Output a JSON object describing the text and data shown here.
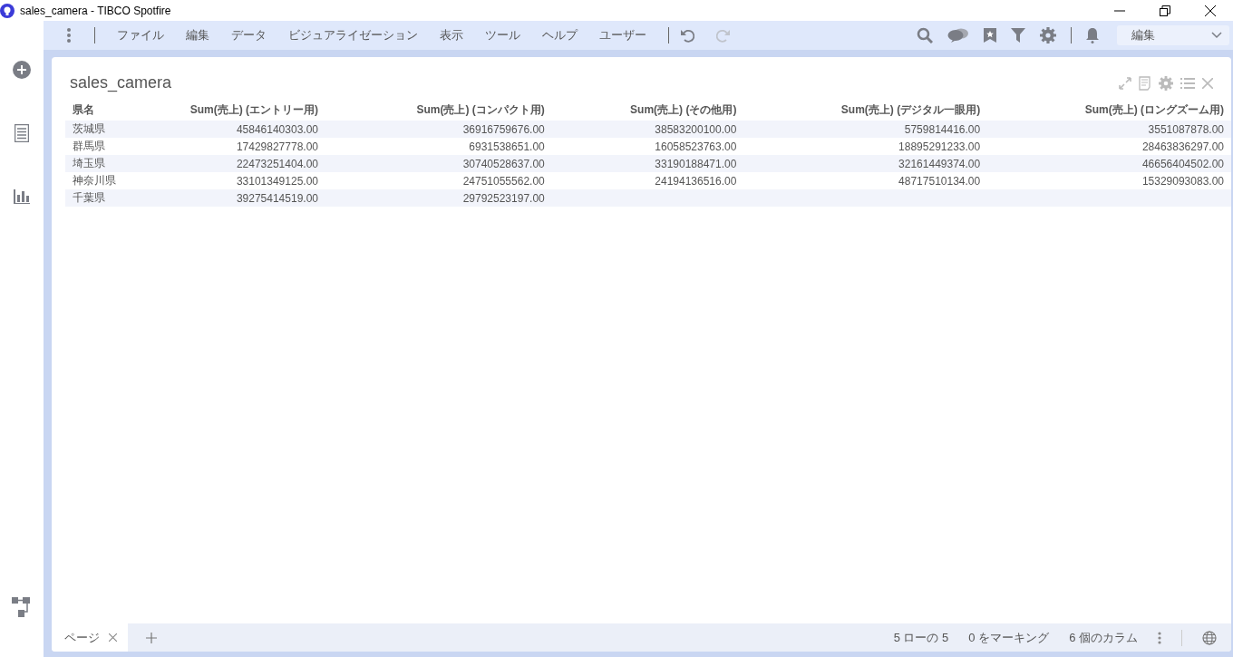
{
  "window": {
    "title": "sales_camera - TIBCO Spotfire"
  },
  "menu": [
    "ファイル",
    "編集",
    "データ",
    "ビジュアライゼーション",
    "表示",
    "ツール",
    "ヘルプ",
    "ユーザー"
  ],
  "mode_dropdown": {
    "value": "編集"
  },
  "visualization": {
    "title": "sales_camera",
    "table": {
      "columns": [
        "県名",
        "Sum(売上) (エントリー用)",
        "Sum(売上) (コンパクト用)",
        "Sum(売上) (その他用)",
        "Sum(売上) (デジタル一眼用)",
        "Sum(売上) (ロングズーム用)"
      ],
      "rows": [
        [
          "茨城県",
          "45846140303.00",
          "36916759676.00",
          "38583200100.00",
          "5759814416.00",
          "3551087878.00"
        ],
        [
          "群馬県",
          "17429827778.00",
          "6931538651.00",
          "16058523763.00",
          "18895291233.00",
          "28463836297.00"
        ],
        [
          "埼玉県",
          "22473251404.00",
          "30740528637.00",
          "33190188471.00",
          "32161449374.00",
          "46656404502.00"
        ],
        [
          "神奈川県",
          "33101349125.00",
          "24751055562.00",
          "24194136516.00",
          "48717510134.00",
          "15329093083.00"
        ],
        [
          "千葉県",
          "39275414519.00",
          "29792523197.00"
        ]
      ]
    }
  },
  "page_tabs": [
    {
      "label": "ページ",
      "selected": true
    }
  ],
  "status_bar": [
    "5 ローの 5",
    "0 をマーキング",
    "6 個のカラム"
  ]
}
